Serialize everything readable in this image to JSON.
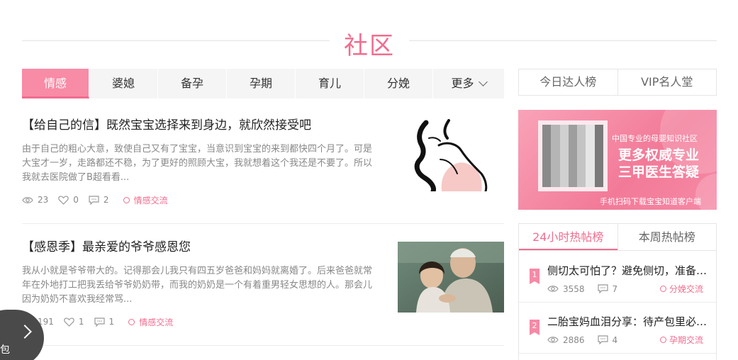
{
  "section": {
    "title": "社区"
  },
  "tabs": [
    {
      "label": "情感",
      "active": true
    },
    {
      "label": "婆媳"
    },
    {
      "label": "备孕"
    },
    {
      "label": "孕期"
    },
    {
      "label": "育儿"
    },
    {
      "label": "分娩"
    }
  ],
  "more_tab": {
    "label": "更多"
  },
  "posts": [
    {
      "title": "【给自己的信】既然宝宝选择来到身边，就欣然接受吧",
      "excerpt": "由于自己的粗心大意，致使自己又有了宝宝，当意识到宝宝的来到都快四个月了。可是大宝才一岁，走路都还不稳，为了更好的照顾大宝，我就想着这个我还是不要了。所以我就去医院做了B超看看...",
      "views": "23",
      "likes": "0",
      "comments": "2",
      "category": "情感交流",
      "image": "pregnant-silhouette-illustration"
    },
    {
      "title": "【感恩季】最亲爱的爷爷感恩您",
      "excerpt": "我从小就是爷爷带大的。记得那会儿我只有四五岁爸爸和妈妈就离婚了。后来爸爸就常年在外地打工把我丢给爷爷奶奶带，而我的奶奶是一个有着重男轻女思想的人。那会儿因为奶奶不喜欢我经常骂...",
      "views": "191",
      "likes": "1",
      "comments": "1",
      "category": "情感交流",
      "image": "grandfather-and-girl-photo"
    }
  ],
  "rank_tabs": [
    "今日达人榜",
    "VIP名人堂"
  ],
  "banner": {
    "line1": "中国专业的母婴知识社区",
    "line2": "更多权威专业 三甲医生答疑",
    "line3": "手机扫码下载宝宝知道客户端",
    "qr": "qr-code"
  },
  "hot_tabs": [
    {
      "label": "24小时热帖榜",
      "active": true
    },
    {
      "label": "本周热帖榜"
    }
  ],
  "hot_posts": [
    {
      "rank": "1",
      "title": "侧切太可怕了？避免侧切，准备这些就够了",
      "views": "3558",
      "comments": "7",
      "category": "分娩交流"
    },
    {
      "rank": "2",
      "title": "二胎宝妈血泪分享：待产包里必备的东西",
      "views": "2886",
      "comments": "4",
      "category": "孕期交流"
    }
  ],
  "float_nav": {
    "label": "包"
  },
  "colors": {
    "accent": "#f06d8f",
    "tab_active_bg": "#f88ba6"
  }
}
